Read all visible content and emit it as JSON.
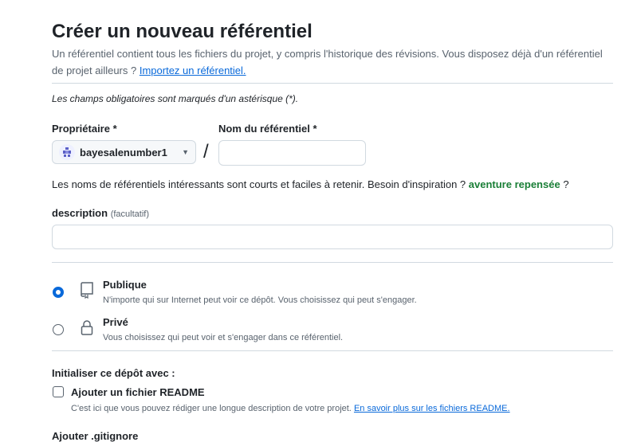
{
  "page": {
    "title": "Créer un nouveau référentiel",
    "intro_text": "Un référentiel contient tous les fichiers du projet, y compris l'historique des révisions. Vous disposez déjà d'un référentiel de projet ailleurs ?",
    "import_link": "Importez un référentiel.",
    "required_note": "Les champs obligatoires sont marqués d'un astérisque (*)."
  },
  "owner": {
    "label": "Propriétaire *",
    "value": "bayesalenumber1",
    "avatar_icon": "identicon-avatar",
    "caret_icon": "caret-down-icon"
  },
  "repo_name": {
    "label": "Nom du référentiel *",
    "value": "",
    "separator": "/"
  },
  "name_hint": {
    "text": "Les noms de référentiels intéressants sont courts et faciles à retenir. Besoin d'inspiration ?",
    "suggestion": "aventure repensée",
    "suffix": "?"
  },
  "description": {
    "label": "description",
    "optional": "(facultatif)",
    "value": ""
  },
  "visibility": {
    "selected": "public",
    "options": [
      {
        "id": "public",
        "title": "Publique",
        "desc": "N'importe qui sur Internet peut voir ce dépôt. Vous choisissez qui peut s'engager.",
        "icon": "repo-icon"
      },
      {
        "id": "private",
        "title": "Privé",
        "desc": "Vous choisissez qui peut voir et s'engager dans ce référentiel.",
        "icon": "lock-icon"
      }
    ]
  },
  "initialize": {
    "label": "Initialiser ce dépôt avec :",
    "readme_label": "Ajouter un fichier README",
    "readme_checked": false,
    "readme_desc": "C'est ici que vous pouvez rédiger une longue description de votre projet.",
    "readme_link": "En savoir plus sur les fichiers README."
  },
  "gitignore": {
    "label": "Ajouter .gitignore"
  },
  "colors": {
    "accent": "#0969da",
    "suggestion": "#1a7f37",
    "muted": "#59636e",
    "border": "#d1d9e0"
  }
}
